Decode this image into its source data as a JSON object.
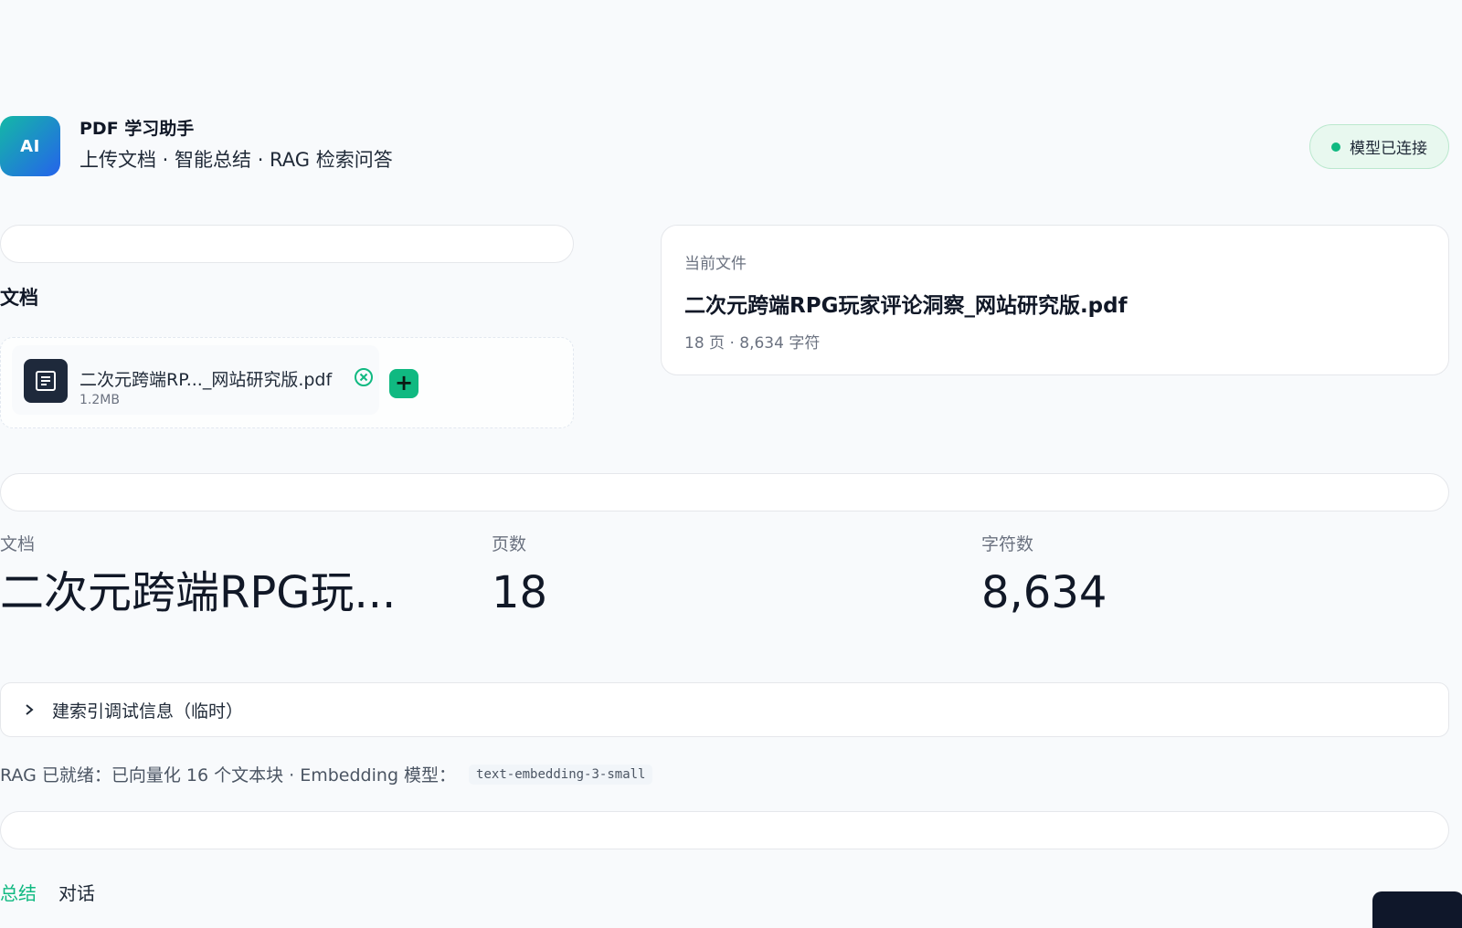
{
  "header": {
    "logo_text": "AI",
    "title": "PDF 学习助手",
    "subtitle": "上传文档 · 智能总结 · RAG 检索问答"
  },
  "status": {
    "label": "模型已连接",
    "color": "#10b981"
  },
  "documents": {
    "section_label": "文档",
    "files": [
      {
        "name": "二次元跨端RP..._网站研究版.pdf",
        "size": "1.2MB",
        "icon": "document-icon"
      }
    ],
    "remove_icon": "close-circle-icon",
    "add_icon": "plus-icon"
  },
  "current_file": {
    "label": "当前文件",
    "name": "二次元跨端RPG玩家评论洞察_网站研究版.pdf",
    "meta": "18 页 · 8,634 字符"
  },
  "metrics": {
    "document": {
      "label": "文档",
      "value": "二次元跨端RPG玩..."
    },
    "pages": {
      "label": "页数",
      "value": "18"
    },
    "chars": {
      "label": "字符数",
      "value": "8,634"
    }
  },
  "expander": {
    "label": "建索引调试信息（临时）",
    "icon": "chevron-right-icon"
  },
  "rag": {
    "text": "RAG 已就绪：已向量化 16 个文本块 · Embedding 模型：",
    "model": "text-embedding-3-small"
  },
  "tabs": [
    {
      "label": "总结",
      "active": true
    },
    {
      "label": "对话",
      "active": false
    }
  ],
  "colors": {
    "accent": "#10b981",
    "logo_gradient_start": "#14b8a6",
    "logo_gradient_end": "#2563eb"
  }
}
